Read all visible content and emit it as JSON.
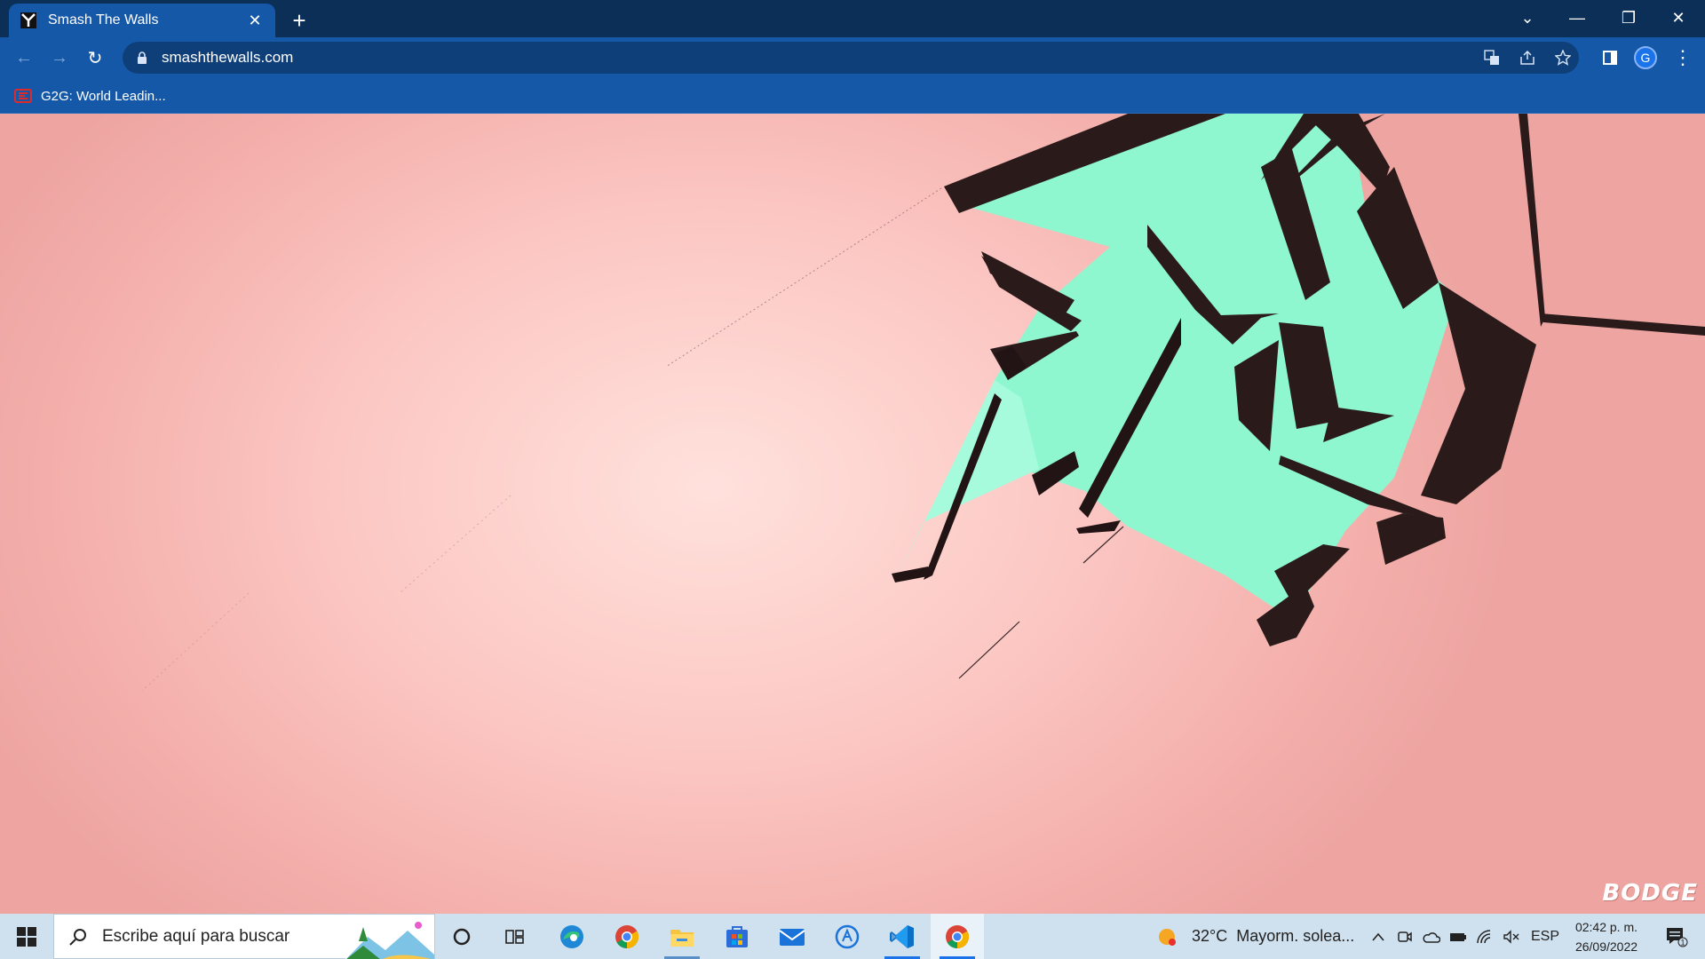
{
  "browser": {
    "tab": {
      "title": "Smash The Walls",
      "close_glyph": "✕"
    },
    "new_tab_glyph": "+",
    "window_controls": {
      "tab_search": "⌄",
      "minimize": "—",
      "restore": "❐",
      "close": "✕"
    },
    "nav": {
      "back": "←",
      "forward": "→",
      "reload": "↻"
    },
    "address": {
      "url": "smashthewalls.com"
    },
    "toolbar_icons": [
      "translate-icon",
      "share-icon",
      "bookmark-star-icon",
      "side-panel-icon"
    ],
    "profile_initial": "G",
    "menu_glyph": "⋮",
    "bookmarks": [
      {
        "label": "G2G: World Leadin..."
      }
    ]
  },
  "page": {
    "watermark": "BODGE",
    "colors": {
      "shard_face": "#8ff7cf",
      "shard_edge": "#2a1a1a",
      "background": "#fcc8c4"
    }
  },
  "taskbar": {
    "search_placeholder": "Escribe aquí para buscar",
    "apps": [
      "cortana-icon",
      "task-view-icon",
      "edge-icon",
      "chrome-icon",
      "file-explorer-icon",
      "store-icon",
      "mail-icon",
      "copilot-icon",
      "vscode-icon",
      "chrome-active-icon"
    ],
    "weather": {
      "temp": "32°C",
      "desc": "Mayorm. solea..."
    },
    "tray": {
      "chevron": "^",
      "language": "ESP"
    },
    "clock": {
      "time": "02:42 p. m.",
      "date": "26/09/2022"
    },
    "notifications_count": "1"
  }
}
